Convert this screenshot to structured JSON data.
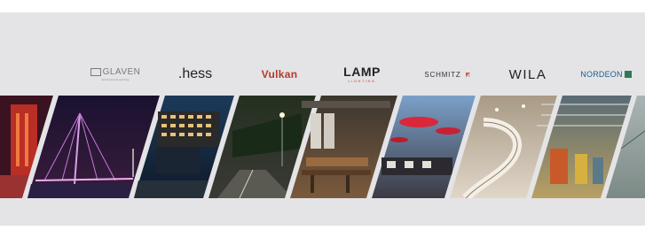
{
  "brands": [
    {
      "name": "GLAVEN",
      "tagline": "architectural lighting"
    },
    {
      "name": ".hess"
    },
    {
      "name": "Vulkan"
    },
    {
      "name": "LAMP",
      "tagline": "LIGHTING"
    },
    {
      "name": "SCHMITZ"
    },
    {
      "name": "WILA"
    },
    {
      "name": "NORDEON"
    }
  ],
  "colors": {
    "background": "#e4e4e6",
    "vulkan_brand": "#b23a2c",
    "lamp_accent": "#d0312d",
    "nordeon_brand": "#1f5c8c",
    "nordeon_mark": "#2e7a55"
  },
  "photos": [
    {
      "subject": "red lit building facade at night"
    },
    {
      "subject": "illuminated cable-stayed bridge at night"
    },
    {
      "subject": "modern office building with lit windows"
    },
    {
      "subject": "street lighting on a road at night"
    },
    {
      "subject": "restaurant interior with pendant lights"
    },
    {
      "subject": "hotel lobby with red circular pendants"
    },
    {
      "subject": "spiral staircase in a bright atrium"
    },
    {
      "subject": "industrial hall with high-bay lighting"
    },
    {
      "subject": "warehouse interior"
    }
  ]
}
